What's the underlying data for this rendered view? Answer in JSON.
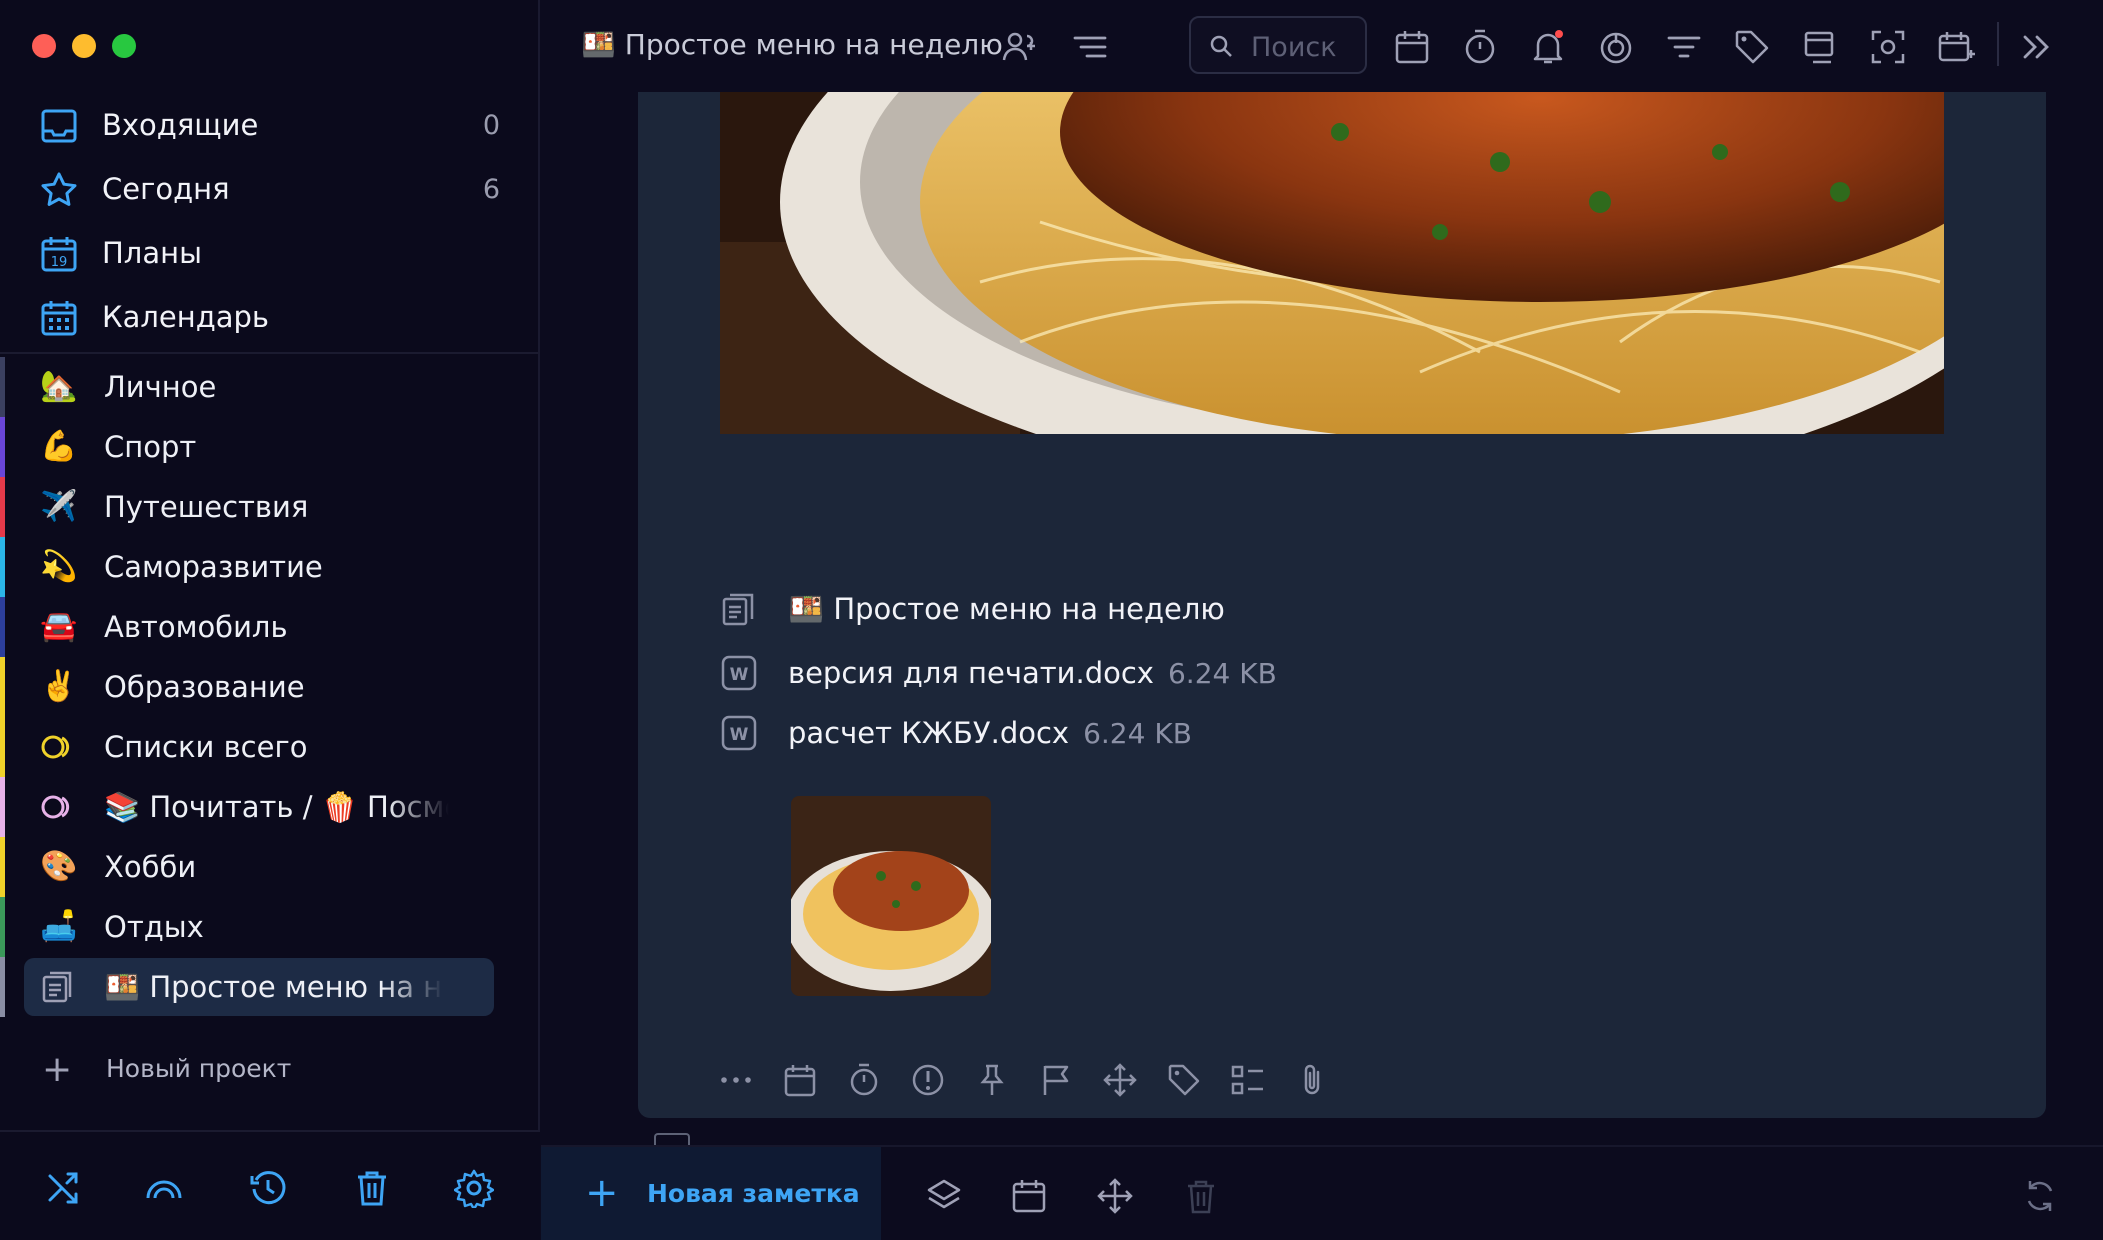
{
  "sidebar": {
    "smart": [
      {
        "label": "Входящие",
        "count": "0",
        "icon": "inbox-icon"
      },
      {
        "label": "Сегодня",
        "count": "6",
        "icon": "star-icon"
      },
      {
        "label": "Планы",
        "count": "",
        "icon": "calendar-19-icon"
      },
      {
        "label": "Календарь",
        "count": "",
        "icon": "calendar-grid-icon"
      }
    ],
    "projects": [
      {
        "label": "Личное",
        "emoji": "🏡",
        "bar": "#3b4060"
      },
      {
        "label": "Спорт",
        "emoji": "💪",
        "bar": "#6a46d8"
      },
      {
        "label": "Путешествия",
        "emoji": "✈️",
        "bar": "#e53a4a"
      },
      {
        "label": "Саморазвитие",
        "emoji": "💫",
        "bar": "#2bb6e8"
      },
      {
        "label": "Автомобиль",
        "emoji": "🚘",
        "bar": "#2d3f9c"
      },
      {
        "label": "Образование",
        "emoji": "✌️",
        "bar": "#f0d22a"
      },
      {
        "label": "Списки всего",
        "emoji": "",
        "bar": "#f0d22a"
      },
      {
        "label": "📚 Почитать / 🍿 Посмотреть",
        "emoji": "",
        "bar": "#e7b2e8"
      },
      {
        "label": "Хобби",
        "emoji": "🎨",
        "bar": "#f0d22a"
      },
      {
        "label": "Отдых",
        "emoji": "🛋️",
        "bar": "#3b9a5a"
      },
      {
        "label": "🍱 Простое меню на неделю",
        "emoji": "",
        "bar": "#8a8ea4"
      }
    ],
    "new_project": "Новый проект"
  },
  "header": {
    "title": "🍱 Простое меню на неделю",
    "search_placeholder": "Поиск"
  },
  "note": {
    "title": "🍱 Простое меню на неделю",
    "attachments": [
      {
        "name": "версия для печати.docx",
        "size": "6.24 KB"
      },
      {
        "name": "расчет КЖБУ.docx",
        "size": "6.24 KB"
      }
    ]
  },
  "bottom": {
    "new_note": "Новая заметка"
  },
  "colors": {
    "accent": "#3ea5f5",
    "notification_dot": "#ff4d4d"
  }
}
